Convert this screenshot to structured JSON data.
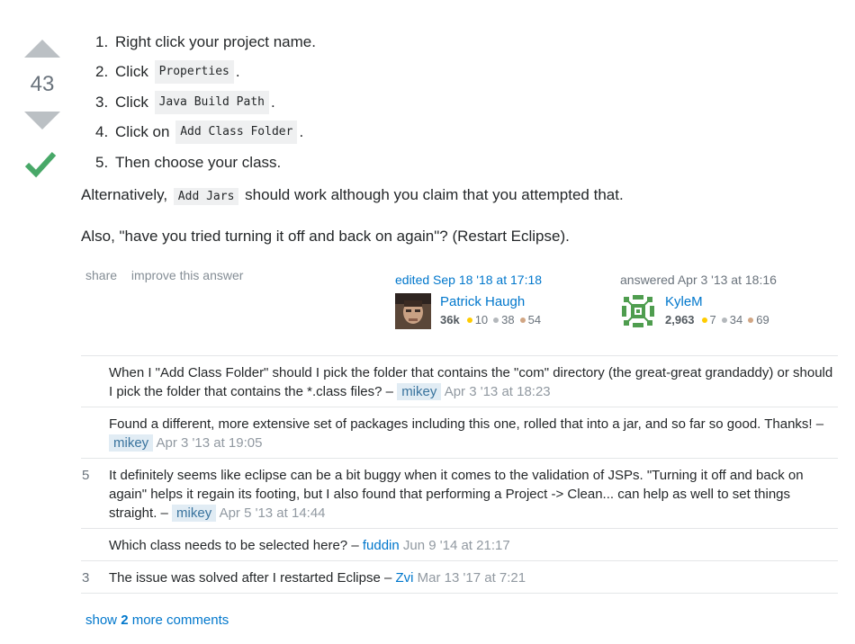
{
  "vote": {
    "count": "43"
  },
  "steps": [
    {
      "num": "1.",
      "before": "Right click your project name.",
      "code": "",
      "after": ""
    },
    {
      "num": "2.",
      "before": "Click",
      "code": "Properties",
      "after": "."
    },
    {
      "num": "3.",
      "before": "Click",
      "code": "Java Build Path",
      "after": "."
    },
    {
      "num": "4.",
      "before": "Click on",
      "code": "Add Class Folder",
      "after": "."
    },
    {
      "num": "5.",
      "before": "Then choose your class.",
      "code": "",
      "after": ""
    }
  ],
  "alt": {
    "before": "Alternatively,",
    "code": "Add Jars",
    "after": "should work although you claim that you attempted that."
  },
  "also": "Also, \"have you tried turning it off and back on again\"? (Restart Eclipse).",
  "menu": {
    "share": "share",
    "improve": "improve this answer"
  },
  "editor": {
    "action": "edited Sep 18 '18 at 17:18",
    "name": "Patrick Haugh",
    "rep": "36k",
    "gold": "10",
    "silver": "38",
    "bronze": "54"
  },
  "answerer": {
    "action": "answered Apr 3 '13 at 18:16",
    "name": "KyleM",
    "rep": "2,963",
    "gold": "7",
    "silver": "34",
    "bronze": "69"
  },
  "comments": [
    {
      "score": "",
      "text": "When I \"Add Class Folder\" should I pick the folder that contains the \"com\" directory (the great-great grandaddy) or should I pick the folder that contains the *.class files? –",
      "user": "mikey",
      "date": "Apr 3 '13 at 18:23"
    },
    {
      "score": "",
      "text": "Found a different, more extensive set of packages including this one, rolled that into a jar, and so far so good. Thanks! –",
      "user": "mikey",
      "date": "Apr 3 '13 at 19:05"
    },
    {
      "score": "5",
      "text": "It definitely seems like eclipse can be a bit buggy when it comes to the validation of JSPs. \"Turning it off and back on again\" helps it regain its footing, but I also found that performing a Project -> Clean... can help as well to set things straight. –",
      "user": "mikey",
      "date": "Apr 5 '13 at 14:44"
    },
    {
      "score": "",
      "text": "Which class needs to be selected here? –",
      "user": "fuddin",
      "date": "Jun 9 '14 at 21:17"
    },
    {
      "score": "3",
      "text": "The issue was solved after I restarted Eclipse –",
      "user": "Zvi",
      "date": "Mar 13 '17 at 7:21"
    }
  ],
  "show_more": {
    "prefix": "show",
    "count": "2",
    "suffix": "more comments"
  },
  "colors": {
    "link": "#0077cc",
    "accepted": "#48a868",
    "vote_arrow": "#bbc0c4"
  }
}
